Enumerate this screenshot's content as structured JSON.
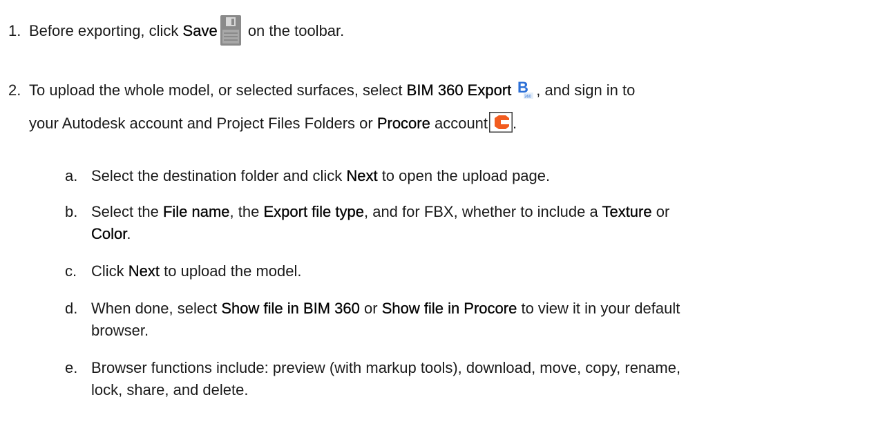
{
  "steps": [
    {
      "number": "1.",
      "text_before": "Before exporting, click ",
      "bold_1": "Save",
      "text_after": " on the toolbar.",
      "icon": "save-disk-icon"
    },
    {
      "number": "2.",
      "text_before": "To upload the whole model, or selected surfaces, select ",
      "bold_1": "BIM 360 Export",
      "text_mid": ", and sign in to",
      "line2_before": "your Autodesk account and Project Files Folders or ",
      "bold_2": "Procore",
      "line2_after": " account",
      "line2_end": ".",
      "icon_1": "bim360-export-icon",
      "icon_2": "procore-icon"
    }
  ],
  "substeps": {
    "a": {
      "letter": "a.",
      "t1": "Select the destination folder and click ",
      "b1": "Next",
      "t2": " to open the upload page."
    },
    "b": {
      "letter": "b.",
      "t1": "Select the ",
      "b1": "File name",
      "t2": ", the ",
      "b2": "Export file type",
      "t3": ", and for FBX, whether to include a ",
      "b3": "Texture",
      "t4": " or",
      "b4": "Color",
      "t5": "."
    },
    "c": {
      "letter": "c.",
      "t1": "Click ",
      "b1": "Next",
      "t2": " to upload the model."
    },
    "d": {
      "letter": "d.",
      "t1": "When done, select ",
      "b1": "Show file in BIM 360",
      "t2": " or ",
      "b2": "Show file in Procore",
      "t3": " to view it in your default",
      "t4": "browser."
    },
    "e": {
      "letter": "e.",
      "t1": "Browser functions include: preview (with markup tools), download, move, copy, rename,",
      "t2": "lock, share, and delete."
    }
  },
  "colors": {
    "text": "#1a1a1a",
    "bim_blue": "#2b6fd6",
    "procore_orange": "#f25c1f",
    "save_gray": "#8a8a8a"
  }
}
